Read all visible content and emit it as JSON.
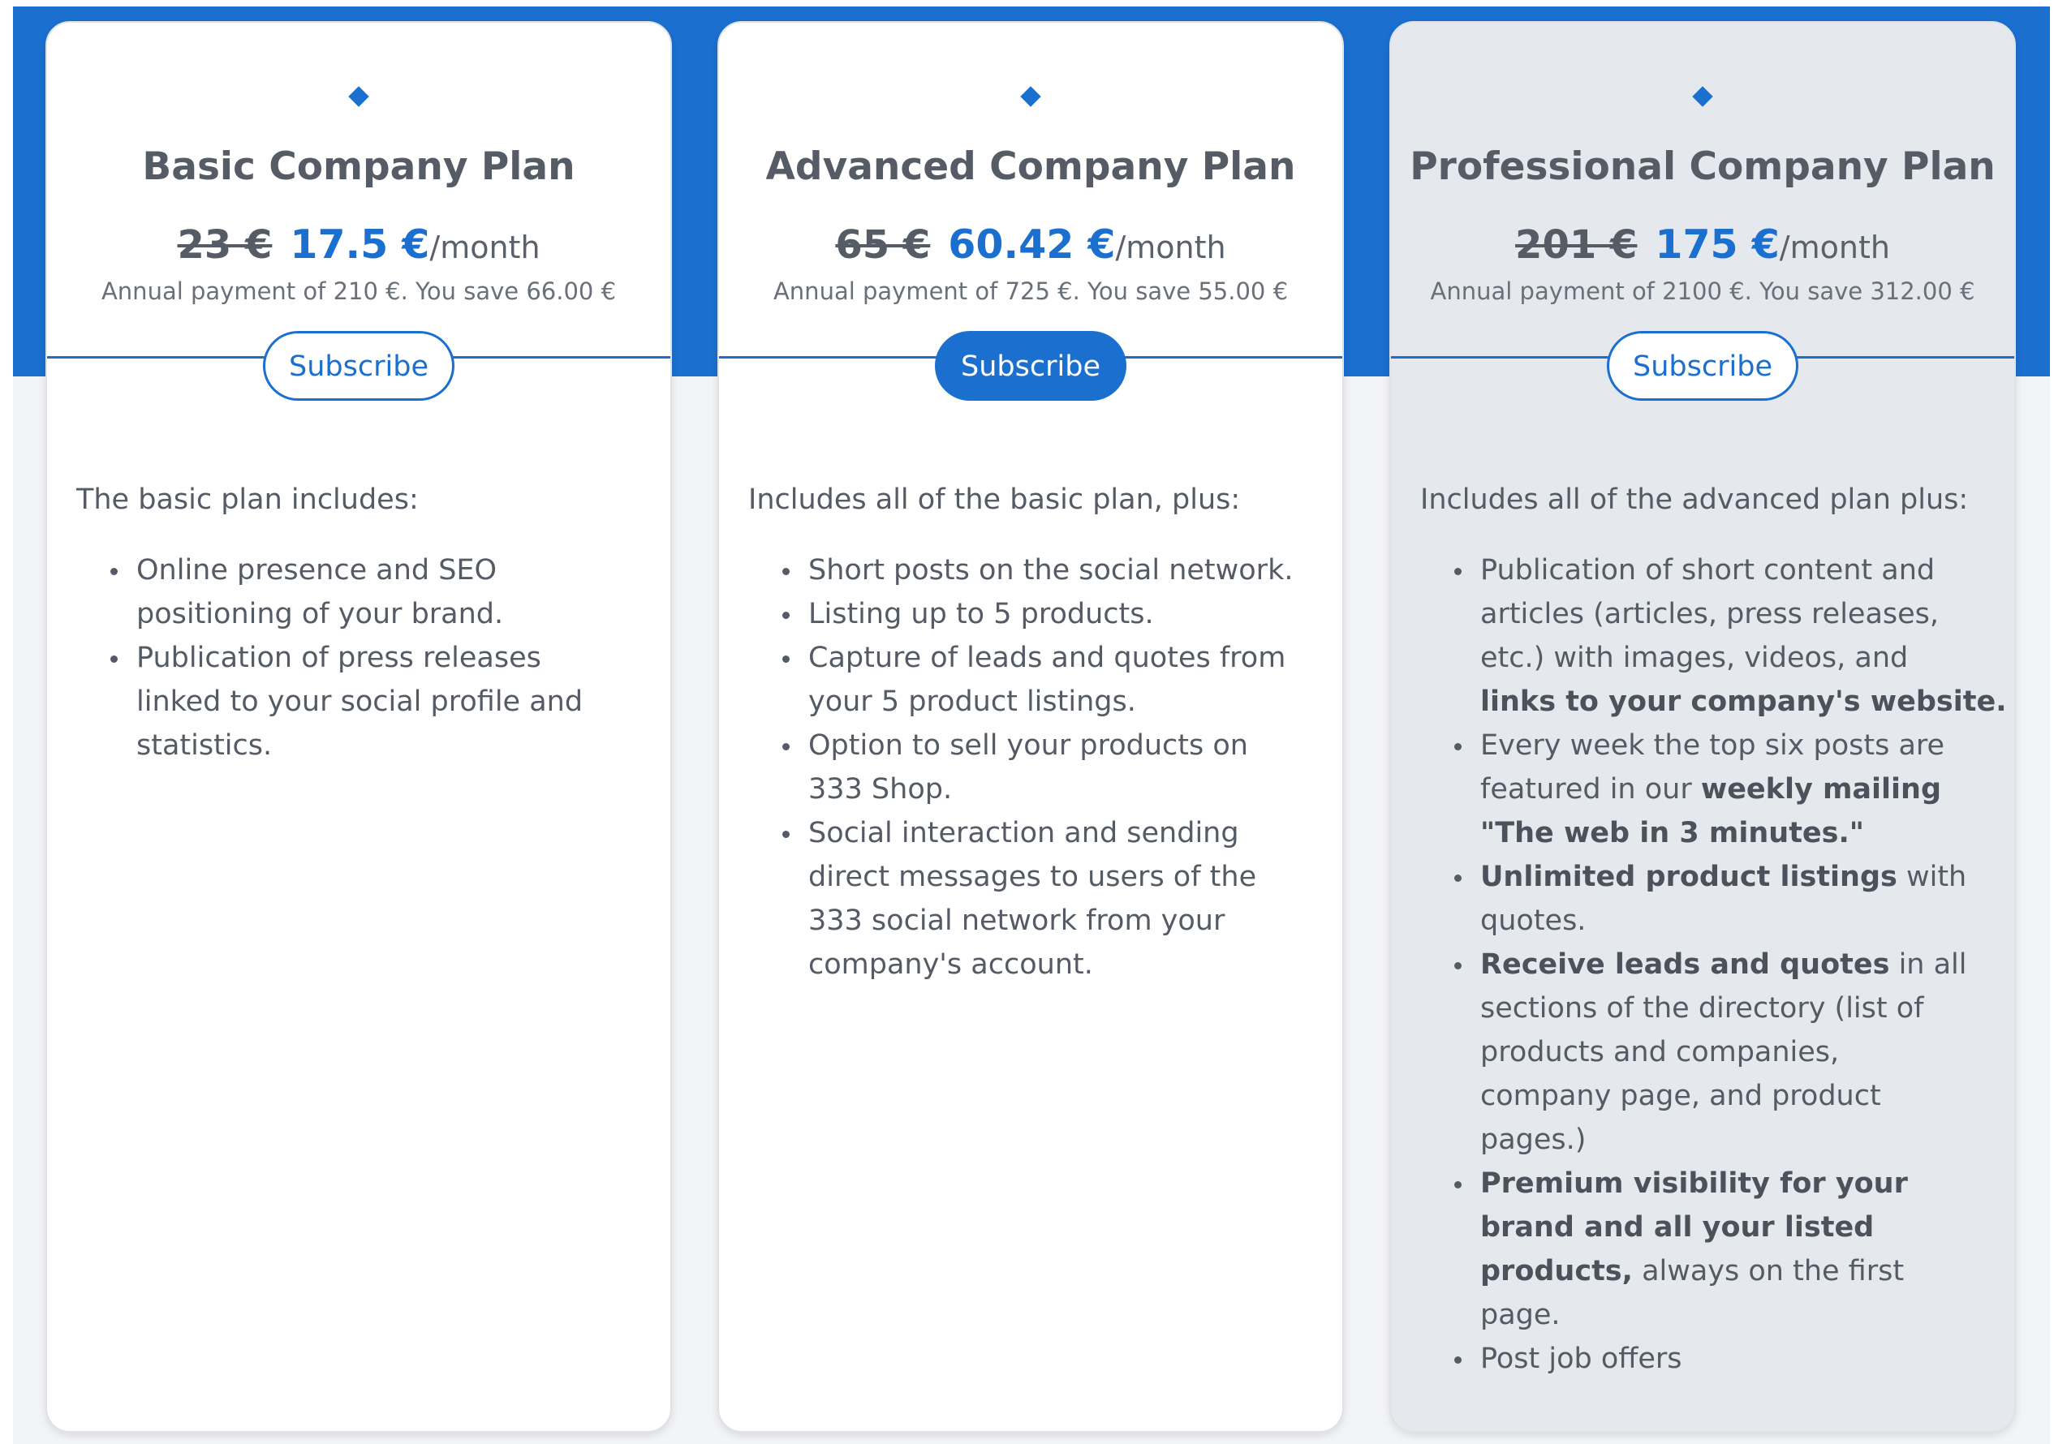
{
  "colors": {
    "accent": "#1b6fcf",
    "card_grey": "#e5e8ed",
    "text": "#555b65"
  },
  "plans": [
    {
      "title": "Basic Company Plan",
      "old_price": "23 €",
      "price": "17.5 €",
      "per": "/month",
      "annual": "Annual payment of 210 €. You save 66.00 €",
      "button": "Subscribe",
      "intro": "The basic plan includes:",
      "features": [
        {
          "lines": [
            [
              "Online presence and SEO"
            ],
            [
              "positioning of your brand."
            ]
          ]
        },
        {
          "lines": [
            [
              "Publication of press releases"
            ],
            [
              "linked to your social profile and"
            ],
            [
              "statistics."
            ]
          ]
        }
      ]
    },
    {
      "title": "Advanced Company Plan",
      "old_price": "65 €",
      "price": "60.42 €",
      "per": "/month",
      "annual": "Annual payment of 725 €. You save 55.00 €",
      "button": "Subscribe",
      "intro": "Includes all of the basic plan, plus:",
      "features": [
        {
          "lines": [
            [
              "Short posts on the social network."
            ]
          ]
        },
        {
          "lines": [
            [
              "Listing up to 5 products."
            ]
          ]
        },
        {
          "lines": [
            [
              "Capture of leads and quotes from"
            ],
            [
              "your 5 product listings."
            ]
          ]
        },
        {
          "lines": [
            [
              "Option to sell your products on"
            ],
            [
              "333 Shop."
            ]
          ]
        },
        {
          "lines": [
            [
              "Social interaction and sending"
            ],
            [
              "direct messages to users of the"
            ],
            [
              "333 social network from your"
            ],
            [
              "company's account."
            ]
          ]
        }
      ]
    },
    {
      "title": "Professional Company Plan",
      "old_price": "201 €",
      "price": "175 €",
      "per": "/month",
      "annual": "Annual payment of 2100 €. You save 312.00 €",
      "button": "Subscribe",
      "intro": "Includes all of the advanced plan plus:",
      "features": [
        {
          "lines": [
            [
              "Publication of short content and"
            ],
            [
              "articles (articles, press releases,"
            ],
            [
              "etc.) with images, videos, and"
            ],
            [
              "",
              "links to your company's website."
            ]
          ]
        },
        {
          "lines": [
            [
              "Every week the top six posts are"
            ],
            [
              "featured in our ",
              "weekly mailing"
            ],
            [
              "",
              "\"The web in 3 minutes.\""
            ]
          ]
        },
        {
          "lines": [
            [
              "",
              "Unlimited product listings",
              " with"
            ],
            [
              "quotes."
            ]
          ]
        },
        {
          "lines": [
            [
              "",
              "Receive leads and quotes",
              " in all"
            ],
            [
              "sections of the directory (list of"
            ],
            [
              "products and companies,"
            ],
            [
              "company page, and product"
            ],
            [
              "pages.)"
            ]
          ]
        },
        {
          "lines": [
            [
              "",
              "Premium visibility for your"
            ],
            [
              "",
              "brand and all your listed"
            ],
            [
              "",
              "products,",
              " always on the first"
            ],
            [
              "page."
            ]
          ]
        },
        {
          "lines": [
            [
              "Post job offers"
            ]
          ]
        }
      ]
    }
  ]
}
